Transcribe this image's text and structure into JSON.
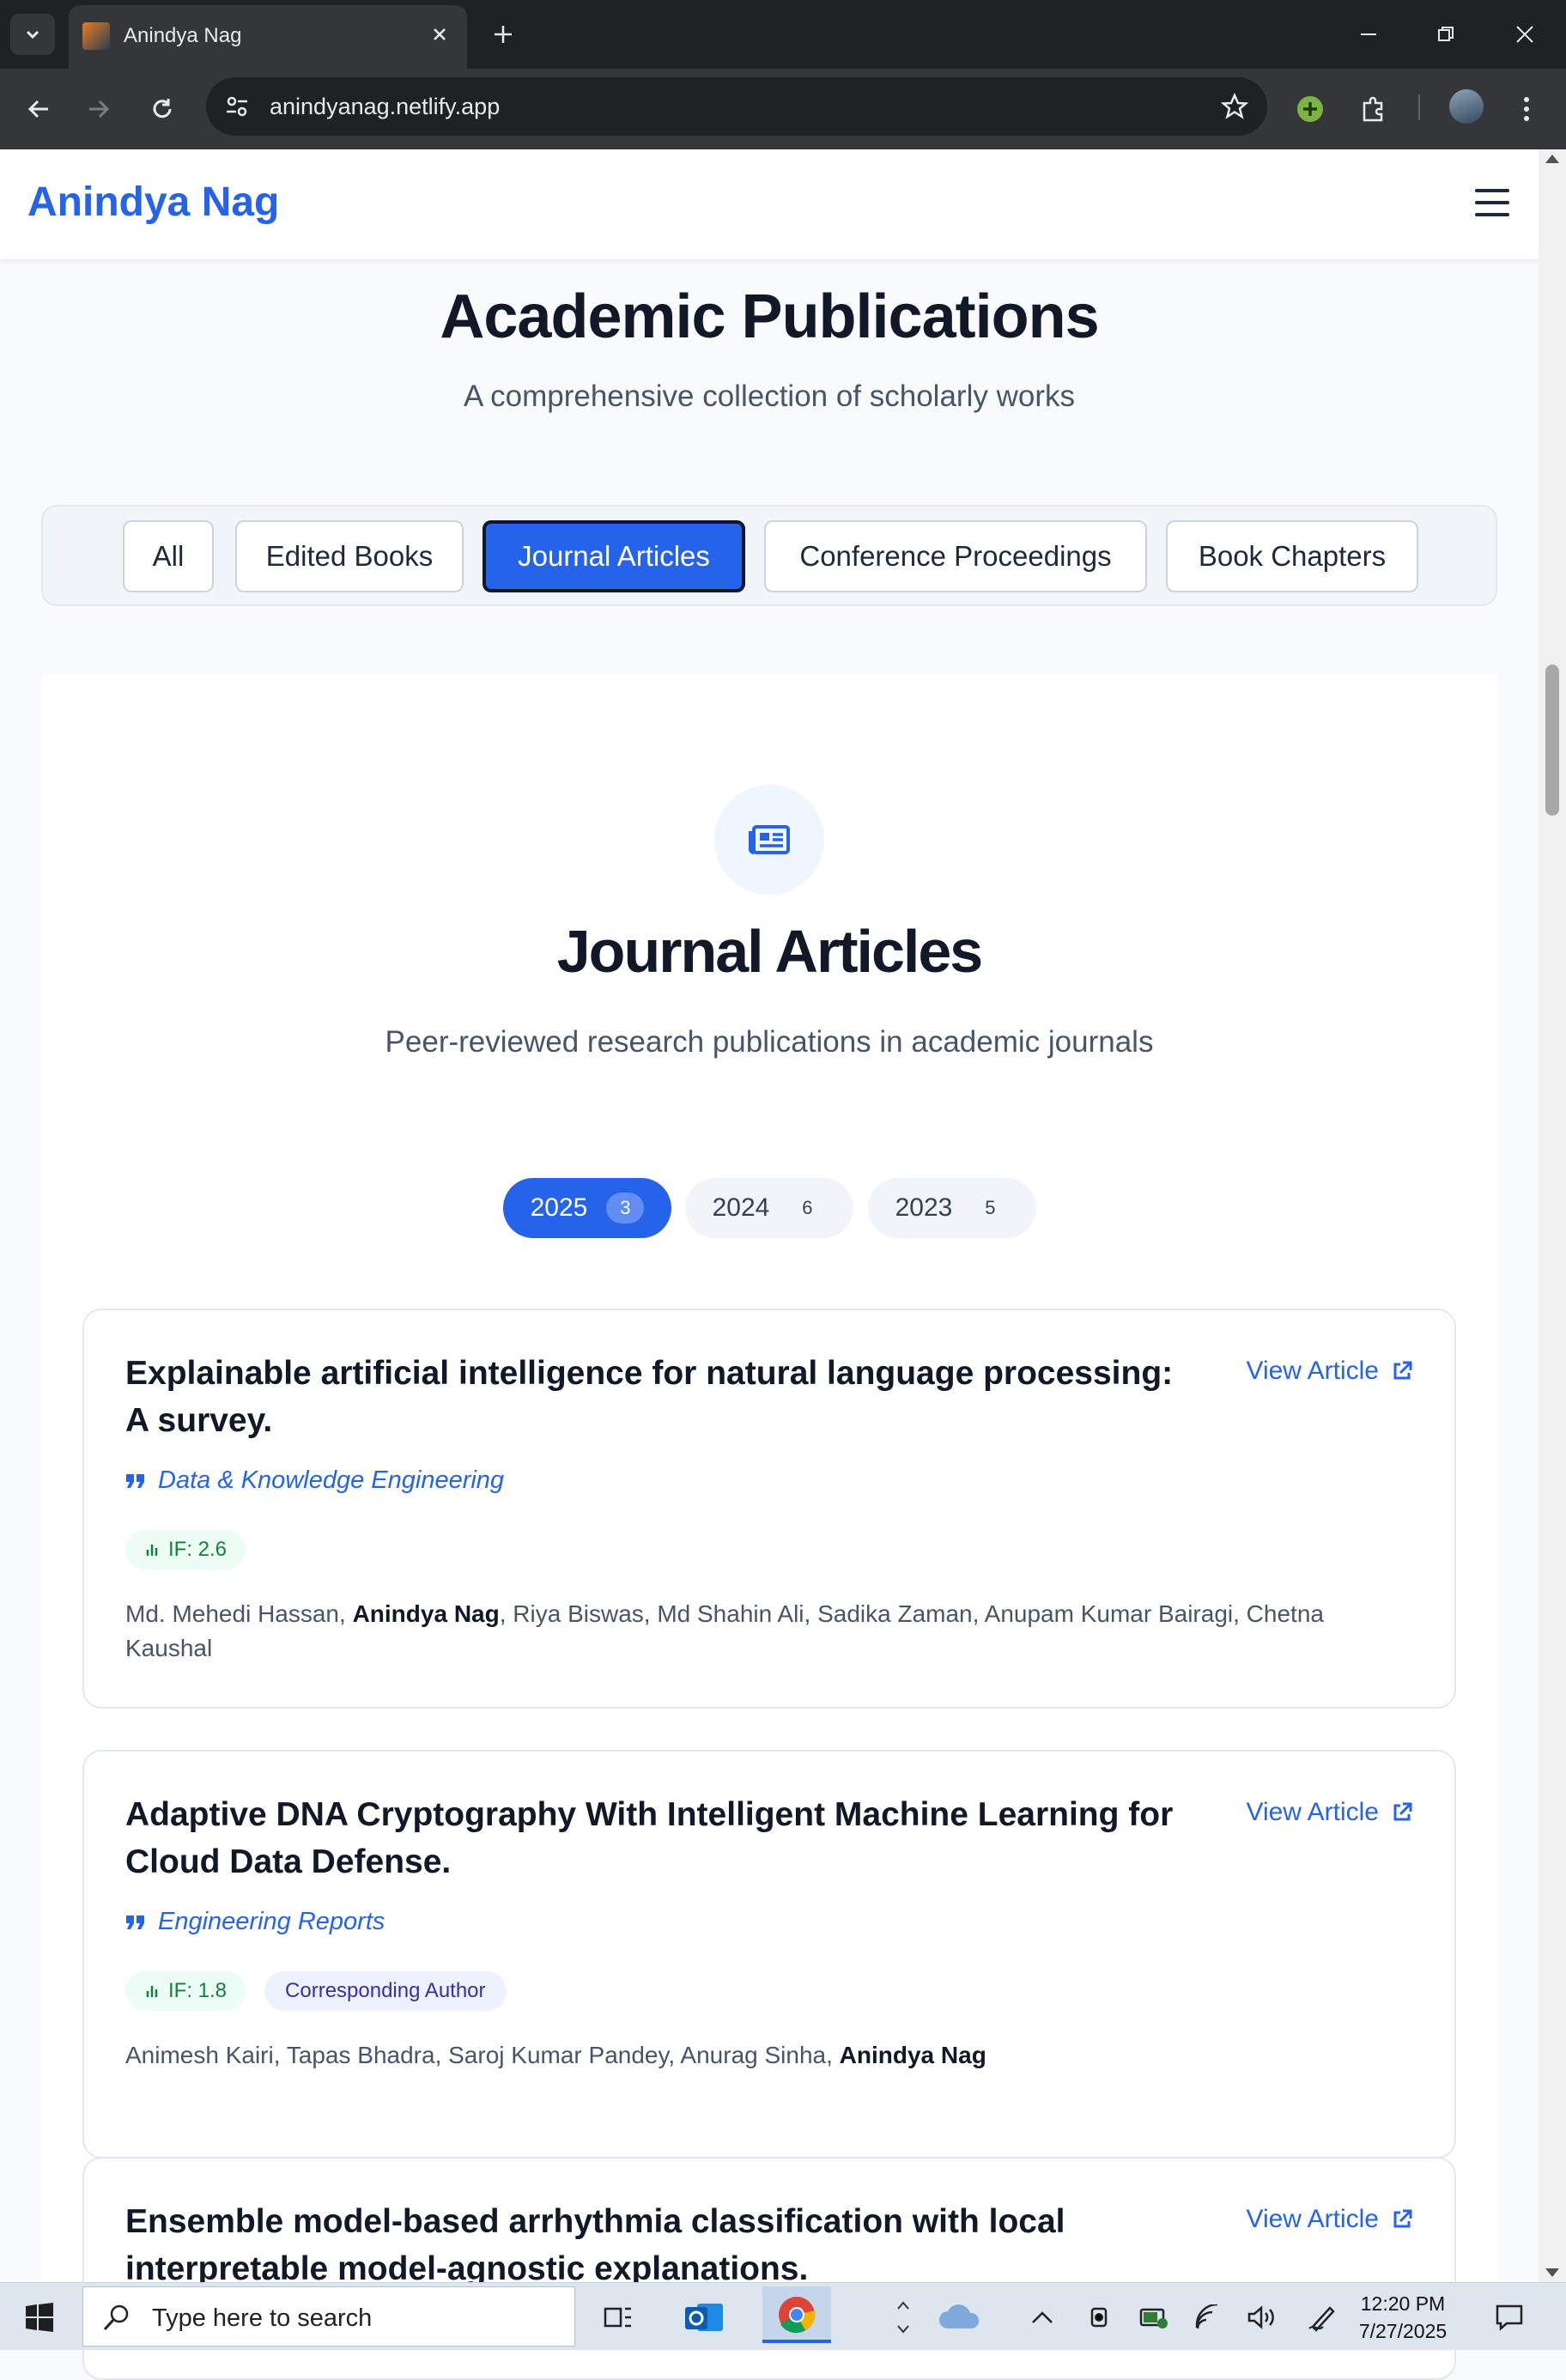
{
  "browser": {
    "tab_title": "Anindya Nag",
    "url": "anindyanag.netlify.app"
  },
  "site": {
    "logo": "Anindya Nag"
  },
  "page": {
    "title": "Academic Publications",
    "subtitle": "A comprehensive collection of scholarly works",
    "filters": [
      {
        "label": "All",
        "active": false
      },
      {
        "label": "Edited Books",
        "active": false
      },
      {
        "label": "Journal Articles",
        "active": true
      },
      {
        "label": "Conference Proceedings",
        "active": false
      },
      {
        "label": "Book Chapters",
        "active": false
      }
    ]
  },
  "section": {
    "icon": "newspaper-icon",
    "title": "Journal Articles",
    "description": "Peer-reviewed research publications in academic journals",
    "years": [
      {
        "year": "2025",
        "count": "3",
        "active": true
      },
      {
        "year": "2024",
        "count": "6",
        "active": false
      },
      {
        "year": "2023",
        "count": "5",
        "active": false
      }
    ]
  },
  "publications": [
    {
      "title": "Explainable artificial intelligence for natural language processing: A survey.",
      "link_label": "View Article",
      "journal": "Data & Knowledge Engineering",
      "impact_factor": "IF: 2.6",
      "authors_before": "Md. Mehedi Hassan, ",
      "author_highlight": "Anindya Nag",
      "authors_after": ", Riya Biswas, Md Shahin Ali, Sadika Zaman, Anupam Kumar Bairagi, Chetna Kaushal"
    },
    {
      "title": "Adaptive DNA Cryptography With Intelligent Machine Learning for Cloud Data Defense.",
      "link_label": "View Article",
      "journal": "Engineering Reports",
      "impact_factor": "IF: 1.8",
      "role_badge": "Corresponding Author",
      "authors_before": "Animesh Kairi, Tapas Bhadra, Saroj Kumar Pandey, Anurag Sinha, ",
      "author_highlight": "Anindya Nag",
      "authors_after": ""
    },
    {
      "title": "Ensemble model-based arrhythmia classification with local interpretable model-agnostic explanations.",
      "link_label": "View Article"
    }
  ],
  "taskbar": {
    "search_placeholder": "Type here to search",
    "time": "12:20 PM",
    "date": "7/27/2025"
  },
  "colors": {
    "brand": "#2563eb",
    "active_border": "#0f172a",
    "if_badge_text": "#15803d",
    "role_badge_text": "#3730a3"
  }
}
